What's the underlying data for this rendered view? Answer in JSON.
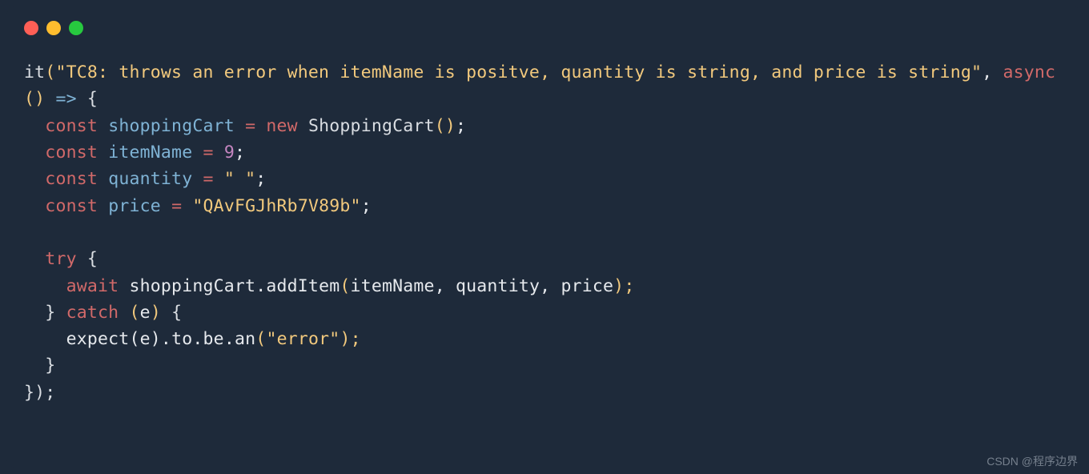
{
  "window": {
    "dots": {
      "red": "#ff5f56",
      "yellow": "#ffbd2e",
      "green": "#27c93f"
    }
  },
  "code": {
    "fn_it": "it",
    "str_test": "\"TC8: throws an error when itemName is positve, quantity is string, and price is string\"",
    "kw_async": "async",
    "arrow": "=>",
    "kw_const": "const",
    "var_shoppingCart": "shoppingCart",
    "kw_new": "new",
    "class_ShoppingCart": "ShoppingCart",
    "var_itemName": "itemName",
    "num_9": "9",
    "var_quantity": "quantity",
    "str_space": "\" \"",
    "var_price": "price",
    "str_price_val": "\"QAvFGJhRb7V89b\"",
    "kw_try": "try",
    "kw_await": "await",
    "method_addItem": "addItem",
    "kw_catch": "catch",
    "var_e": "e",
    "fn_expect": "expect",
    "method_to": "to",
    "method_be": "be",
    "method_an": "an",
    "str_error": "\"error\"",
    "op_eq": "=",
    "comma": ", ",
    "lparen": "(",
    "rparen": ")",
    "lbrace": "{",
    "rbrace": "}",
    "semi": ";",
    "dot": ".",
    "empty_parens": "()",
    "close_paren_semi": ");",
    "close_rbrace_rparen_semi": "});"
  },
  "watermark": "CSDN @程序边界"
}
